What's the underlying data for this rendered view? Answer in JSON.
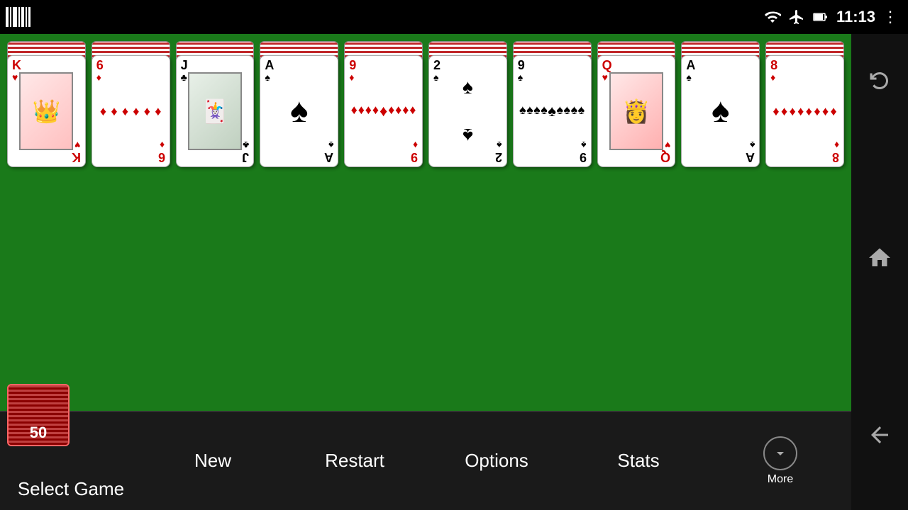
{
  "statusBar": {
    "clock": "11:13",
    "overflowLabel": "⋮"
  },
  "columns": [
    {
      "id": "col1",
      "rank": "K",
      "suit": "♥",
      "color": "red",
      "type": "face",
      "label": "King of Hearts"
    },
    {
      "id": "col2",
      "rank": "6",
      "suit": "♦",
      "color": "red",
      "type": "number",
      "pips": 6,
      "label": "Six of Diamonds"
    },
    {
      "id": "col3",
      "rank": "J",
      "suit": "♣",
      "color": "black",
      "type": "face",
      "label": "Jack of Clubs"
    },
    {
      "id": "col4",
      "rank": "A",
      "suit": "♠",
      "color": "black",
      "type": "ace",
      "label": "Ace of Spades"
    },
    {
      "id": "col5",
      "rank": "9",
      "suit": "♦",
      "color": "red",
      "type": "number",
      "pips": 9,
      "label": "Nine of Diamonds"
    },
    {
      "id": "col6",
      "rank": "2",
      "suit": "♠",
      "color": "black",
      "type": "number",
      "pips": 2,
      "label": "Two of Spades"
    },
    {
      "id": "col7",
      "rank": "9",
      "suit": "♠",
      "color": "black",
      "type": "number",
      "pips": 9,
      "label": "Nine of Spades"
    },
    {
      "id": "col8",
      "rank": "Q",
      "suit": "♥",
      "color": "red",
      "type": "face",
      "label": "Queen of Hearts"
    },
    {
      "id": "col9",
      "rank": "A",
      "suit": "♠",
      "color": "black",
      "type": "ace",
      "label": "Ace of Spades"
    },
    {
      "id": "col10",
      "rank": "8",
      "suit": "♦",
      "color": "red",
      "type": "number",
      "pips": 8,
      "label": "Eight of Diamonds"
    }
  ],
  "bottomBar": {
    "selectGame": "Select Game",
    "gameNumber": "50",
    "new": "New",
    "restart": "Restart",
    "options": "Options",
    "stats": "Stats",
    "more": "More"
  },
  "navBar": {
    "rotateIcon": "⬜",
    "homeIcon": "⌂",
    "backIcon": "←"
  }
}
